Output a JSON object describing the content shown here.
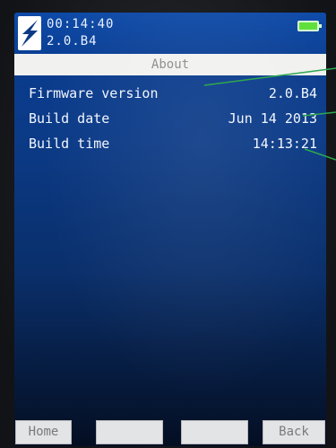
{
  "status": {
    "time": "00:14:40",
    "version": "2.0.B4",
    "battery_color": "#5de03a"
  },
  "title": "About",
  "rows": [
    {
      "label": "Firmware version",
      "value": "2.0.B4"
    },
    {
      "label": "Build date",
      "value": "Jun 14 2013"
    },
    {
      "label": "Build time",
      "value": "14:13:21"
    }
  ],
  "softkeys": [
    "Home",
    "",
    "",
    "Back"
  ],
  "colors": {
    "screen_blue": "#0a3d92",
    "title_bar": "#f1f1ef",
    "callout_green": "#2fa84f"
  }
}
